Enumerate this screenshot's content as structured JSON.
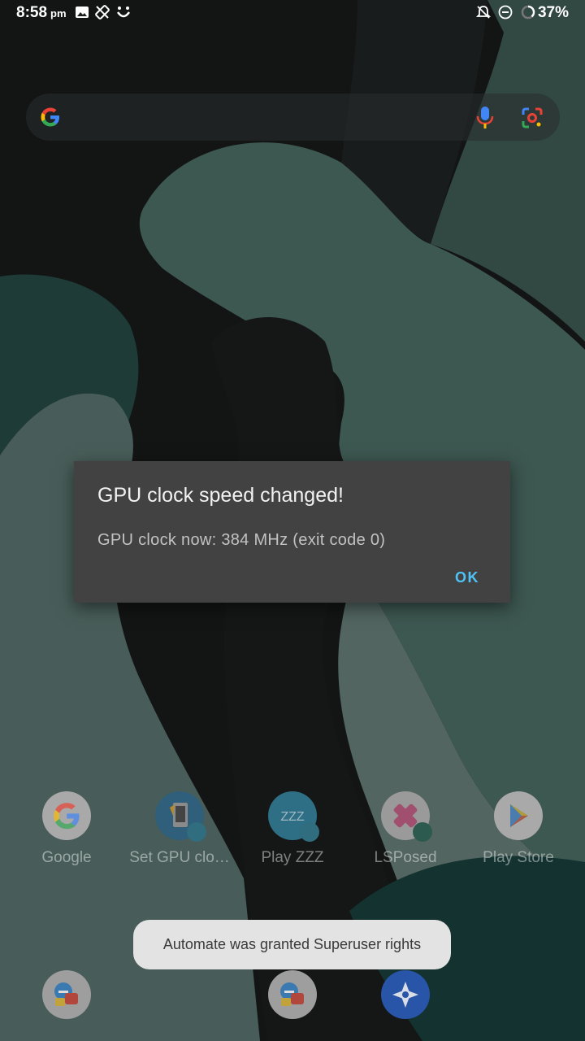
{
  "status_bar": {
    "time": "8:58",
    "ampm": "pm",
    "battery_percent": "37%",
    "icons_left": [
      "image-icon",
      "rotation-lock-icon",
      "smile-icon"
    ],
    "icons_right": [
      "notifications-off-icon",
      "do-not-disturb-icon",
      "battery-ring-icon"
    ]
  },
  "search_bar": {
    "icons": [
      "google-icon",
      "mic-icon",
      "lens-icon"
    ]
  },
  "dialog": {
    "title": "GPU clock speed changed!",
    "message": "GPU clock now: 384 MHz (exit code 0)",
    "ok_label": "OK"
  },
  "apps": [
    {
      "label": "Google",
      "icon": "google-icon"
    },
    {
      "label": "Set GPU clo…",
      "icon": "set-gpu-clock-icon"
    },
    {
      "label": "Play ZZZ",
      "icon": "play-zzz-icon"
    },
    {
      "label": "LSPosed",
      "icon": "lsposed-icon"
    },
    {
      "label": "Play Store",
      "icon": "play-store-icon"
    }
  ],
  "dock": {
    "icons": [
      "automate-icon",
      "automate-icon",
      "compass-icon"
    ]
  },
  "toast": {
    "text": "Automate was granted Superuser rights"
  },
  "colors": {
    "dialog_bg": "#424242",
    "accent": "#4fc3f7",
    "toast_bg": "#e3e3e3"
  }
}
